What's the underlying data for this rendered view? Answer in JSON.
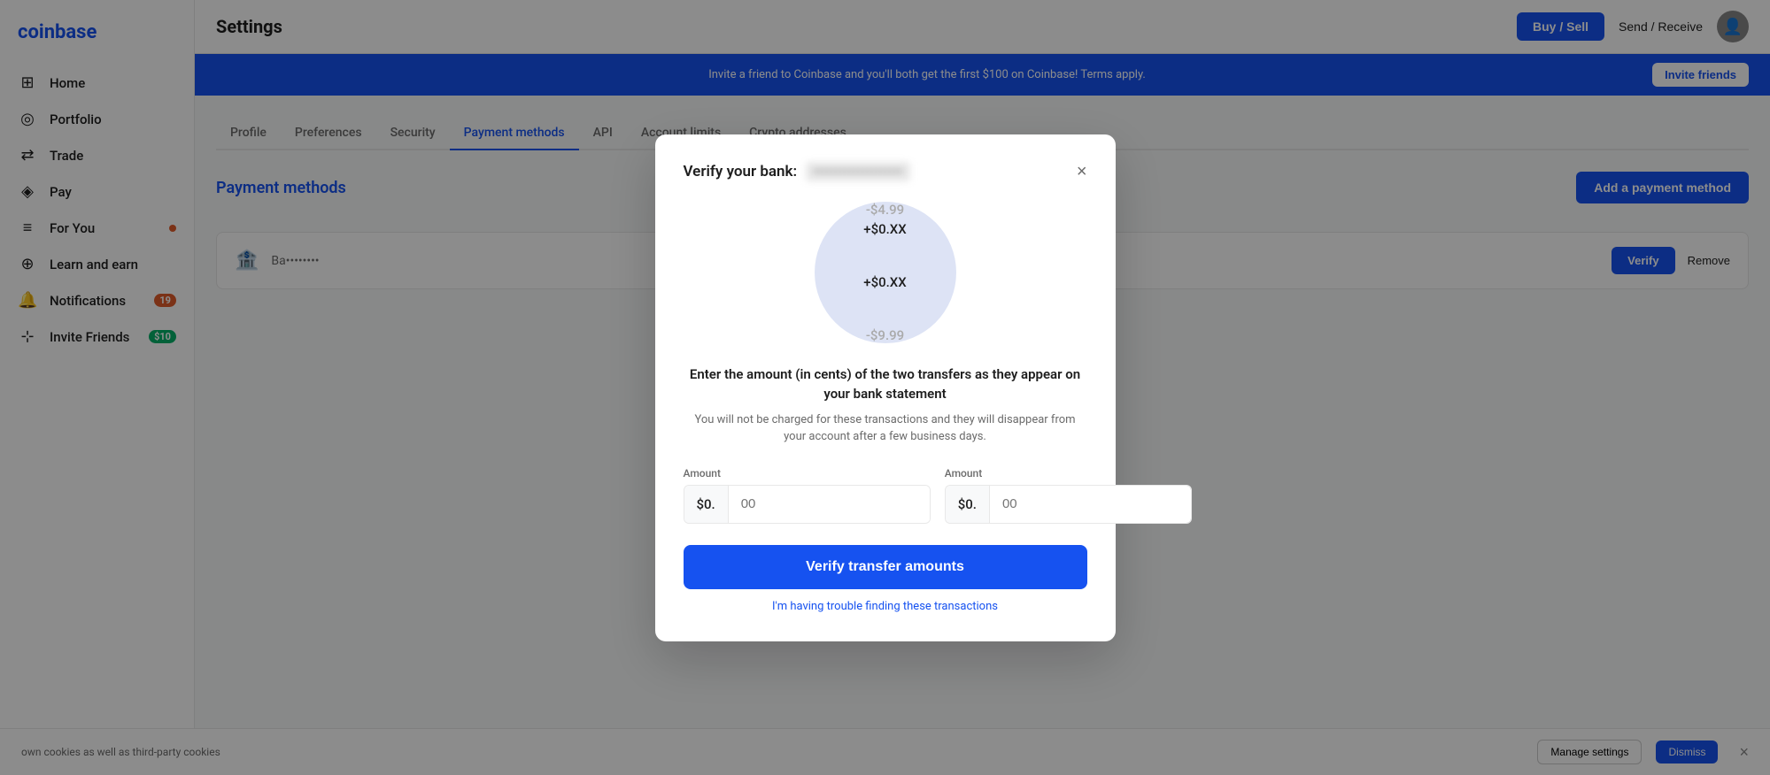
{
  "sidebar": {
    "logo": "coinbase",
    "items": [
      {
        "id": "home",
        "label": "Home",
        "icon": "⊞",
        "badge": null
      },
      {
        "id": "portfolio",
        "label": "Portfolio",
        "icon": "◎",
        "badge": null
      },
      {
        "id": "trade",
        "label": "Trade",
        "icon": "↔",
        "badge": null
      },
      {
        "id": "pay",
        "label": "Pay",
        "icon": "◈",
        "badge": null
      },
      {
        "id": "foryou",
        "label": "For You",
        "icon": "≡",
        "badge": "dot"
      },
      {
        "id": "learnandearn",
        "label": "Learn and earn",
        "icon": "⊕",
        "badge": null
      },
      {
        "id": "notifications",
        "label": "Notifications",
        "icon": "🔔",
        "badge": "19"
      },
      {
        "id": "invitefriends",
        "label": "Invite Friends",
        "icon": "⊹",
        "badge": "$10"
      }
    ]
  },
  "topbar": {
    "settings_title": "Settings",
    "buy_sell_label": "Buy / Sell",
    "send_receive_label": "Send / Receive"
  },
  "banner": {
    "text": "Invite a friend to Coinbase and you'll both get the first $100 on Coinbase! Terms apply.",
    "invite_label": "Invite friends"
  },
  "tabs": [
    {
      "id": "profile",
      "label": "Profile"
    },
    {
      "id": "preferences",
      "label": "Preferences"
    },
    {
      "id": "security",
      "label": "Security"
    },
    {
      "id": "payment_methods",
      "label": "Payment methods",
      "active": true
    },
    {
      "id": "api",
      "label": "API"
    },
    {
      "id": "account_limits",
      "label": "Account limits"
    },
    {
      "id": "crypto_addresses",
      "label": "Crypto addresses"
    }
  ],
  "payment_methods": {
    "section_title": "Payment methods",
    "add_button_label": "Add a payment method",
    "bank": {
      "name": "Bank",
      "verify_label": "Verify",
      "remove_label": "Remove"
    }
  },
  "modal": {
    "title": "Verify your bank:",
    "bank_name_blurred": "••••••••••••••••••••",
    "close_icon": "×",
    "amounts": [
      {
        "value": "-$4.99",
        "style": "muted"
      },
      {
        "value": "+$0.XX",
        "style": "main"
      },
      {
        "value": "+$0.XX",
        "style": "main"
      },
      {
        "value": "-$9.99",
        "style": "muted"
      }
    ],
    "desc_main": "Enter the amount (in cents) of the two transfers as they appear on your bank statement",
    "desc_sub": "You will not be charged for these transactions and they will disappear from your account after a few business days.",
    "amount1_label": "Amount",
    "amount1_prefix": "$0.",
    "amount1_placeholder": "00",
    "amount2_label": "Amount",
    "amount2_prefix": "$0.",
    "amount2_placeholder": "00",
    "verify_button_label": "Verify transfer amounts",
    "trouble_link_label": "I'm having trouble finding these transactions"
  },
  "cookie_bar": {
    "text": "own cookies as well as third-party cookies",
    "manage_label": "Manage settings",
    "dismiss_label": "Dismiss"
  }
}
